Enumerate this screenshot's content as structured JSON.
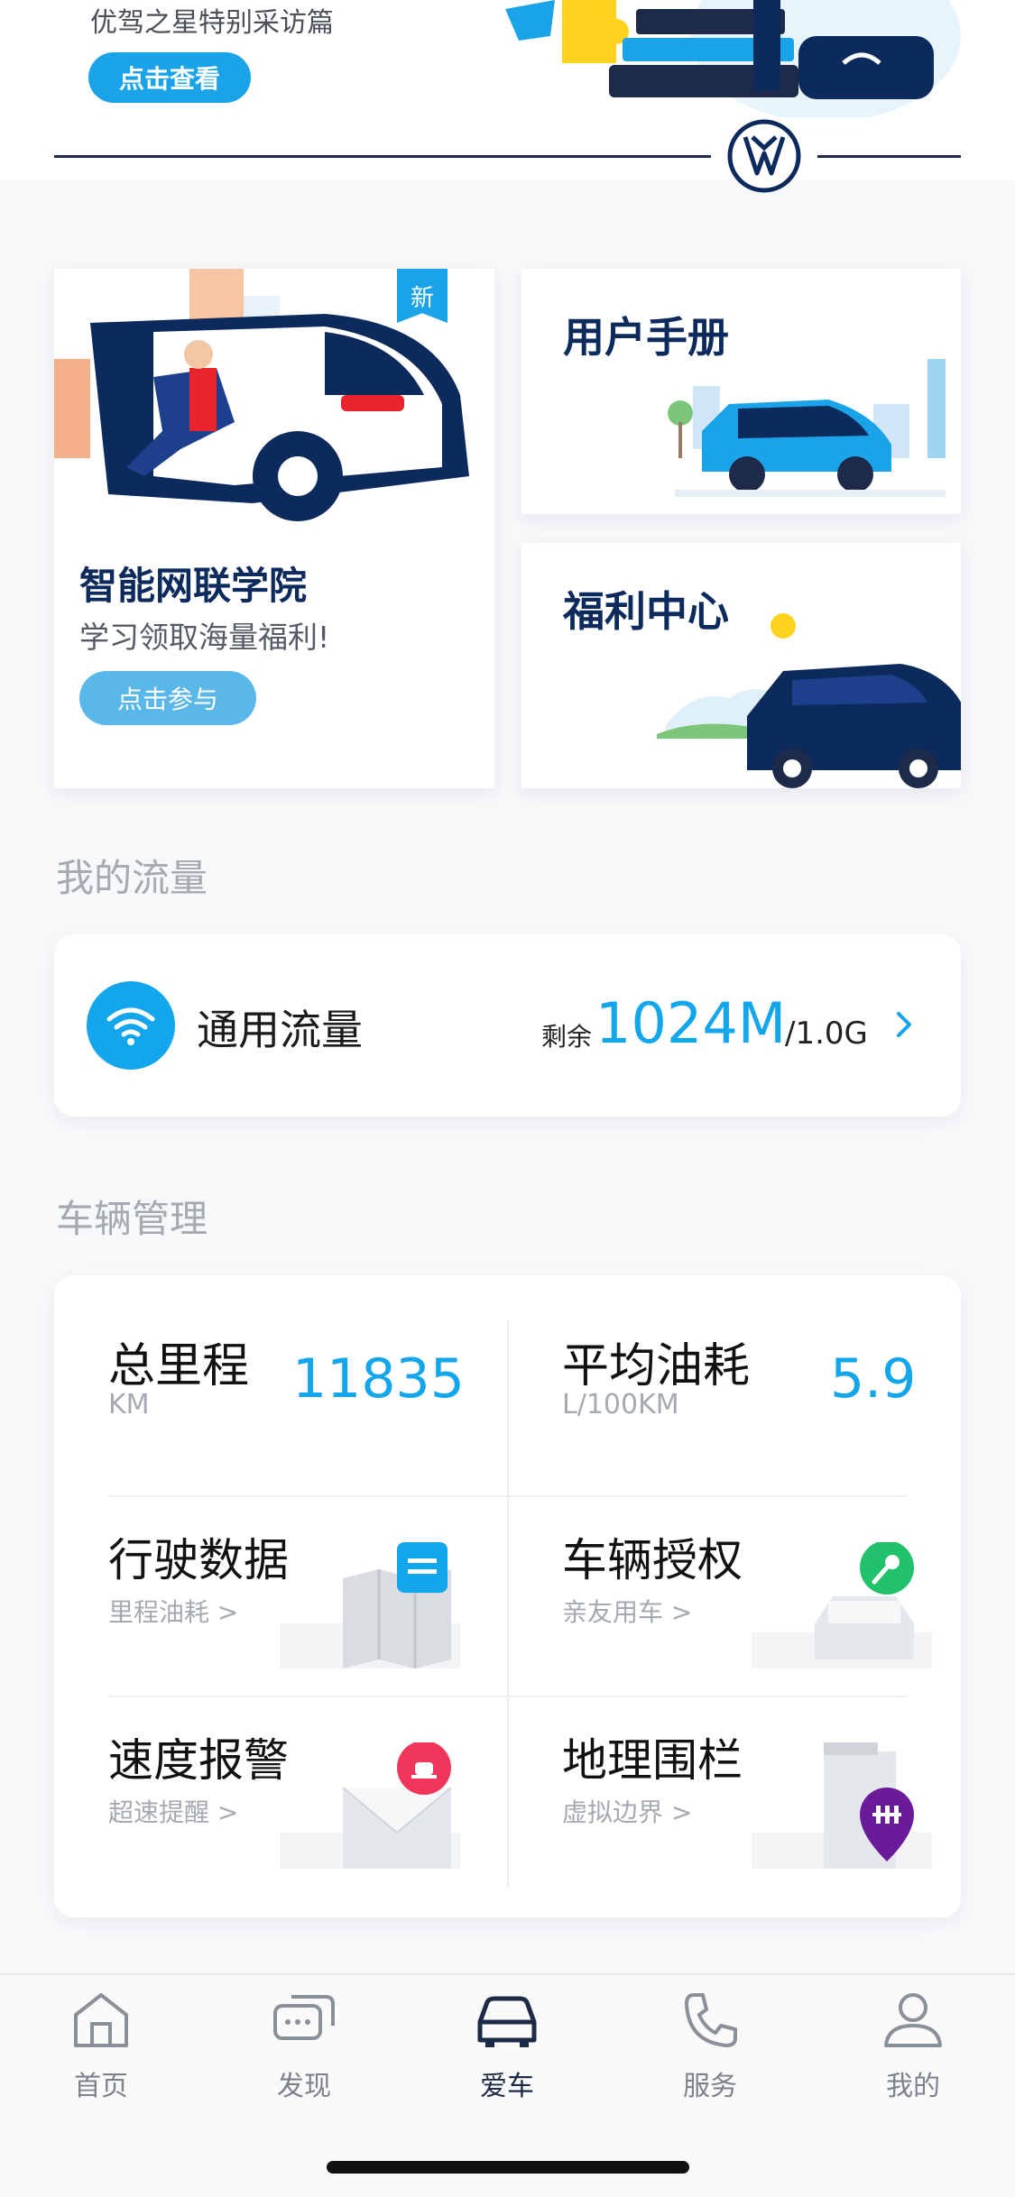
{
  "banner": {
    "subtitle": "优驾之星特别采访篇",
    "button_label": "点击查看"
  },
  "cards": {
    "academy": {
      "badge": "新",
      "title": "智能网联学院",
      "subtitle": "学习领取海量福利!",
      "button_label": "点击参与"
    },
    "manual": {
      "title": "用户手册"
    },
    "benefit": {
      "title": "福利中心"
    }
  },
  "data_section": {
    "heading": "我的流量",
    "label": "通用流量",
    "remaining_label": "剩余",
    "remaining_value": "1024M",
    "total": "/1.0G"
  },
  "vehicle_section": {
    "heading": "车辆管理",
    "mileage": {
      "label": "总里程",
      "unit": "KM",
      "value": "11835"
    },
    "fuel": {
      "label": "平均油耗",
      "unit": "L/100KM",
      "value": "5.9"
    },
    "features": [
      {
        "title": "行驶数据",
        "subtitle": "里程油耗 >"
      },
      {
        "title": "车辆授权",
        "subtitle": "亲友用车 >"
      },
      {
        "title": "速度报警",
        "subtitle": "超速提醒 >"
      },
      {
        "title": "地理围栏",
        "subtitle": "虚拟边界 >"
      }
    ]
  },
  "tabbar": {
    "items": [
      {
        "label": "首页",
        "icon": "home-icon"
      },
      {
        "label": "发现",
        "icon": "chat-bubbles-icon"
      },
      {
        "label": "爱车",
        "icon": "car-icon",
        "active": true
      },
      {
        "label": "服务",
        "icon": "phone-icon"
      },
      {
        "label": "我的",
        "icon": "user-icon"
      }
    ]
  },
  "colors": {
    "accent": "#14a6ec",
    "navy": "#0c2a5c",
    "muted": "#a4a9b2"
  }
}
